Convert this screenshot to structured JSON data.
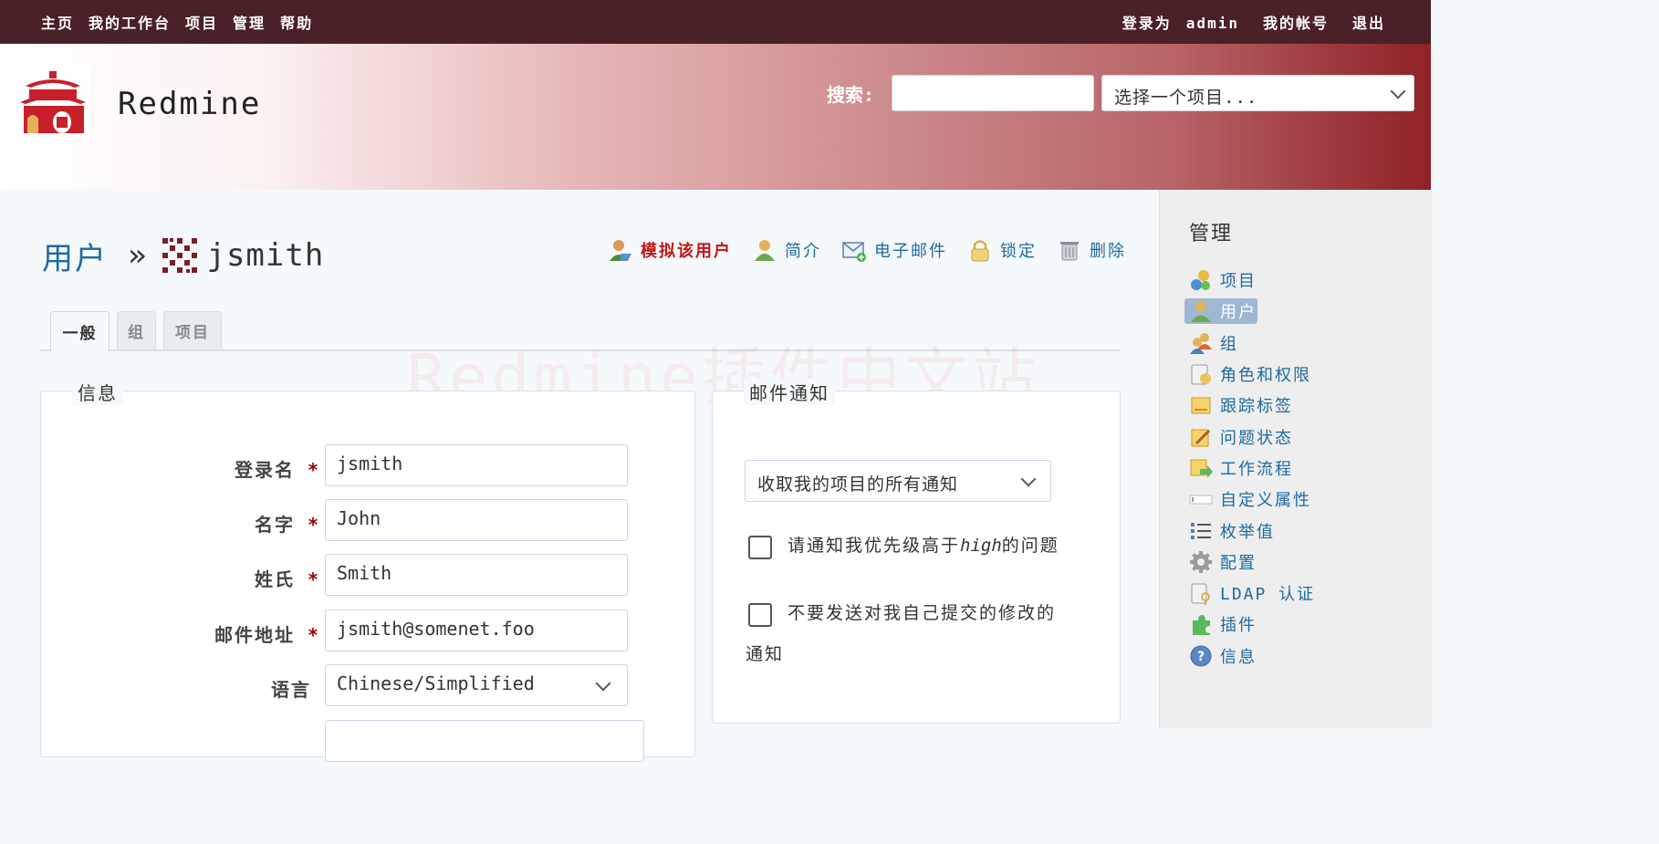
{
  "topbar": {
    "nav": [
      "主页",
      "我的工作台",
      "项目",
      "管理",
      "帮助"
    ],
    "logged_as_label": "登录为",
    "logged_user": "admin",
    "my_account": "我的帐号",
    "logout": "退出"
  },
  "header": {
    "app_title": "Redmine",
    "search_label": "搜索:",
    "search_value": "",
    "project_select": "选择一个项目..."
  },
  "page": {
    "breadcrumb_link": "用户",
    "separator": "»",
    "username": "jsmith"
  },
  "actions": [
    {
      "label": "模拟该用户",
      "icon": "impersonate-icon"
    },
    {
      "label": "简介",
      "icon": "profile-icon"
    },
    {
      "label": "电子邮件",
      "icon": "email-icon"
    },
    {
      "label": "锁定",
      "icon": "lock-icon"
    },
    {
      "label": "删除",
      "icon": "delete-icon"
    }
  ],
  "tabs": [
    "一般",
    "组",
    "项目"
  ],
  "watermark": "Redmine插件中文站",
  "info": {
    "legend": "信息",
    "required_mark": "*",
    "fields": [
      {
        "label": "登录名",
        "value": "jsmith"
      },
      {
        "label": "名字",
        "value": "John"
      },
      {
        "label": "姓氏",
        "value": "Smith"
      },
      {
        "label": "邮件地址",
        "value": "jsmith@somenet.foo"
      },
      {
        "label": "语言",
        "value": "Chinese/Simplified"
      }
    ]
  },
  "mail": {
    "legend": "邮件通知",
    "notify_option": "收取我的项目的所有通知",
    "priority_prefix": "请通知我优先级高于",
    "priority_value": "high",
    "priority_suffix": "的问题",
    "no_self_line1": "不要发送对我自己提交的修改的",
    "no_self_line2": "通知"
  },
  "sidebar": {
    "title": "管理",
    "items": [
      {
        "label": "项目",
        "icon": "projects-icon"
      },
      {
        "label": "用户",
        "icon": "users-icon"
      },
      {
        "label": "组",
        "icon": "groups-icon"
      },
      {
        "label": "角色和权限",
        "icon": "roles-icon"
      },
      {
        "label": "跟踪标签",
        "icon": "trackers-icon"
      },
      {
        "label": "问题状态",
        "icon": "issue-status-icon"
      },
      {
        "label": "工作流程",
        "icon": "workflow-icon"
      },
      {
        "label": "自定义属性",
        "icon": "custom-fields-icon"
      },
      {
        "label": "枚举值",
        "icon": "enumerations-icon"
      },
      {
        "label": "配置",
        "icon": "settings-icon"
      },
      {
        "label": "LDAP 认证",
        "icon": "ldap-icon"
      },
      {
        "label": "插件",
        "icon": "plugins-icon"
      },
      {
        "label": "信息",
        "icon": "info-icon"
      }
    ],
    "selected_index": 1
  },
  "colors": {
    "topbar": "#4a2126",
    "header_end": "#8e2125",
    "link": "#1d6aa0",
    "required": "#a00000",
    "selected_bg": "#9fb7d3"
  }
}
